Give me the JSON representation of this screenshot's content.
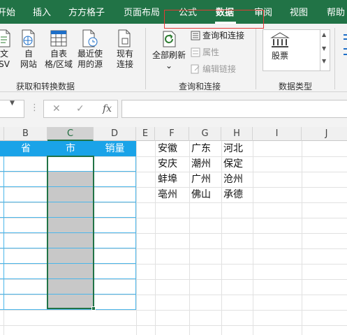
{
  "tabs": [
    {
      "label": "开始",
      "active": false
    },
    {
      "label": "插入",
      "active": false
    },
    {
      "label": "方方格子",
      "active": false
    },
    {
      "label": "页面布局",
      "active": false
    },
    {
      "label": "公式",
      "active": false
    },
    {
      "label": "数据",
      "active": true
    },
    {
      "label": "审阅",
      "active": false
    },
    {
      "label": "视图",
      "active": false
    },
    {
      "label": "帮助",
      "active": false
    }
  ],
  "ribbon": {
    "get_transform": {
      "group_label": "获取和转换数据",
      "from_text_l1": "文",
      "from_text_l2": "SV",
      "from_web_l1": "自",
      "from_web_l2": "网站",
      "from_table_l1": "自表",
      "from_table_l2": "格/区域",
      "recent_l1": "最近使",
      "recent_l2": "用的源",
      "existing_l1": "现有",
      "existing_l2": "连接"
    },
    "queries": {
      "group_label": "查询和连接",
      "refresh_all": "全部刷新",
      "refresh_arrow": "⌄",
      "queries_connections": "查询和连接",
      "properties": "属性",
      "edit_links": "编辑链接"
    },
    "data_types": {
      "group_label": "数据类型",
      "stocks": "股票"
    }
  },
  "formula_bar": {
    "fx_label": "fx",
    "cancel_glyph": "✕",
    "enter_glyph": "✓",
    "value": ""
  },
  "grid": {
    "columns": [
      "B",
      "C",
      "D",
      "E",
      "F",
      "G",
      "H",
      "I",
      "J"
    ],
    "table_headers": [
      "省",
      "市",
      "销量"
    ],
    "lists": [
      [
        "安徽",
        "安庆",
        "蚌埠",
        "亳州"
      ],
      [
        "广东",
        "潮州",
        "广州",
        "佛山"
      ],
      [
        "河北",
        "保定",
        "沧州",
        "承德"
      ]
    ]
  },
  "colors": {
    "accent": "#217346",
    "table_header": "#1aa3e8",
    "highlight_box": "#e53935"
  }
}
